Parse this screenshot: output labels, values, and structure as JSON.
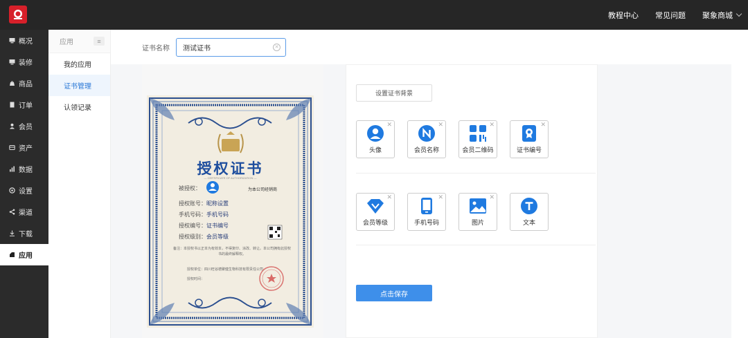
{
  "topnav": {
    "items": [
      "教程中心",
      "常见问题"
    ],
    "store": "聚象商城"
  },
  "leftnav": [
    {
      "label": "概况",
      "icon": "monitor-icon"
    },
    {
      "label": "装修",
      "icon": "monitor-icon"
    },
    {
      "label": "商品",
      "icon": "bag-icon"
    },
    {
      "label": "订单",
      "icon": "order-icon"
    },
    {
      "label": "会员",
      "icon": "user-icon"
    },
    {
      "label": "资产",
      "icon": "asset-icon"
    },
    {
      "label": "数据",
      "icon": "chart-icon"
    },
    {
      "label": "设置",
      "icon": "gear-icon"
    },
    {
      "label": "渠道",
      "icon": "share-icon"
    },
    {
      "label": "下载",
      "icon": "download-icon"
    },
    {
      "label": "应用",
      "icon": "app-icon"
    }
  ],
  "subnav": {
    "header": "应用",
    "items": [
      "我的应用",
      "证书管理",
      "认领记录"
    ]
  },
  "form": {
    "cert_name_label": "证书名称",
    "cert_name_value": "测试证书"
  },
  "certificate": {
    "title": "授权证书",
    "subtitle": "— CERTIFICATE OF AUTHORIZATION —",
    "grantee_label": "被授权：",
    "grantee_role": "为本公司经销商",
    "account_label": "授权账号：",
    "account_value": "昵称设置",
    "phone_label": "手机号码：",
    "phone_value": "手机号码",
    "number_label": "授权编号：",
    "number_value": "证书编号",
    "level_label": "授权级别：",
    "level_value": "会员等级",
    "note": "备注：本授权书以正本为有效本，不得复印、涂改、转让。本公司拥有此授权书的最终解释权。",
    "unit_label": "授权单位：四川旺谷德聚健生物科技有限责任公司",
    "time_label": "授权时间："
  },
  "editor": {
    "bg_button": "设置证书背景",
    "row1": [
      {
        "label": "头像",
        "icon": "avatar-icon"
      },
      {
        "label": "会员名称",
        "icon": "name-icon"
      },
      {
        "label": "会员二维码",
        "icon": "qrcode-icon"
      },
      {
        "label": "证书编号",
        "icon": "certificate-icon"
      }
    ],
    "row2": [
      {
        "label": "会员等级",
        "icon": "diamond-icon"
      },
      {
        "label": "手机号码",
        "icon": "phone-icon"
      },
      {
        "label": "图片",
        "icon": "image-icon"
      },
      {
        "label": "文本",
        "icon": "text-icon"
      }
    ],
    "save_button": "点击保存"
  },
  "colors": {
    "accent": "#3e8fea",
    "icon_blue": "#1f7ae0",
    "topbar": "#262626",
    "sidebar": "#2b2b2b",
    "cert_blue": "#1e4e9e",
    "logo_red": "#d7202a"
  }
}
